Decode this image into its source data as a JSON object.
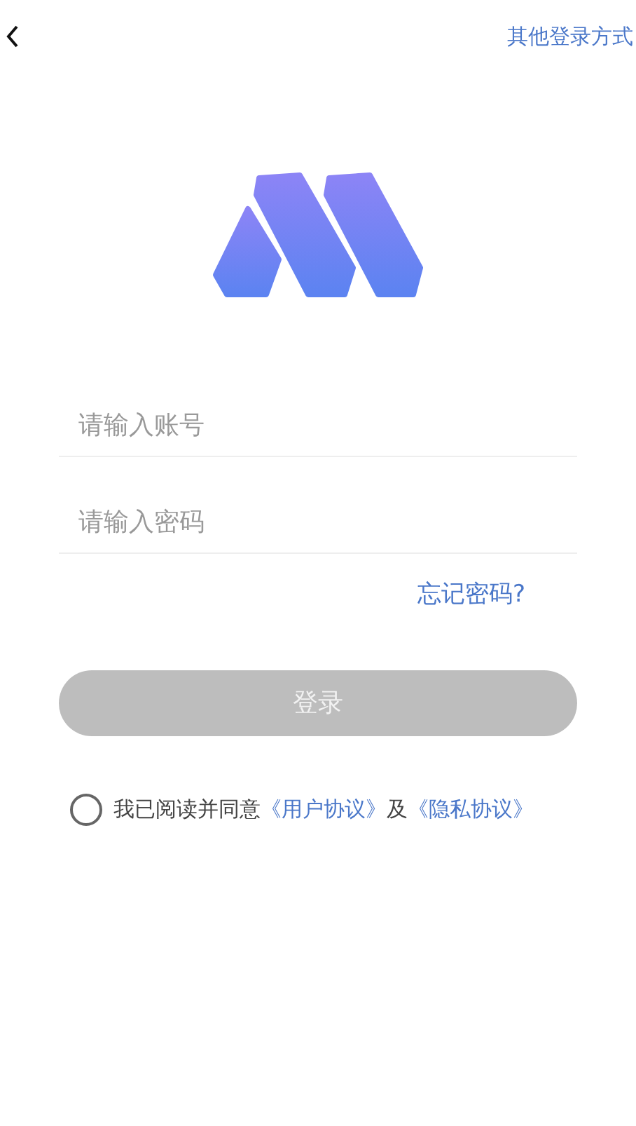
{
  "header": {
    "other_login": "其他登录方式"
  },
  "fields": [
    {
      "placeholder": "请输入账号"
    },
    {
      "placeholder": "请输入密码"
    }
  ],
  "forgot_password": "忘记密码?",
  "login_button": {
    "label": "登录",
    "disabled": true
  },
  "agreement": {
    "checked": false,
    "parts": [
      {
        "kind": "text",
        "text": "我已阅读并同意"
      },
      {
        "kind": "link",
        "text": "《用户协议》"
      },
      {
        "kind": "text",
        "text": "及"
      },
      {
        "kind": "link",
        "text": "《隐私协议》"
      }
    ]
  }
}
